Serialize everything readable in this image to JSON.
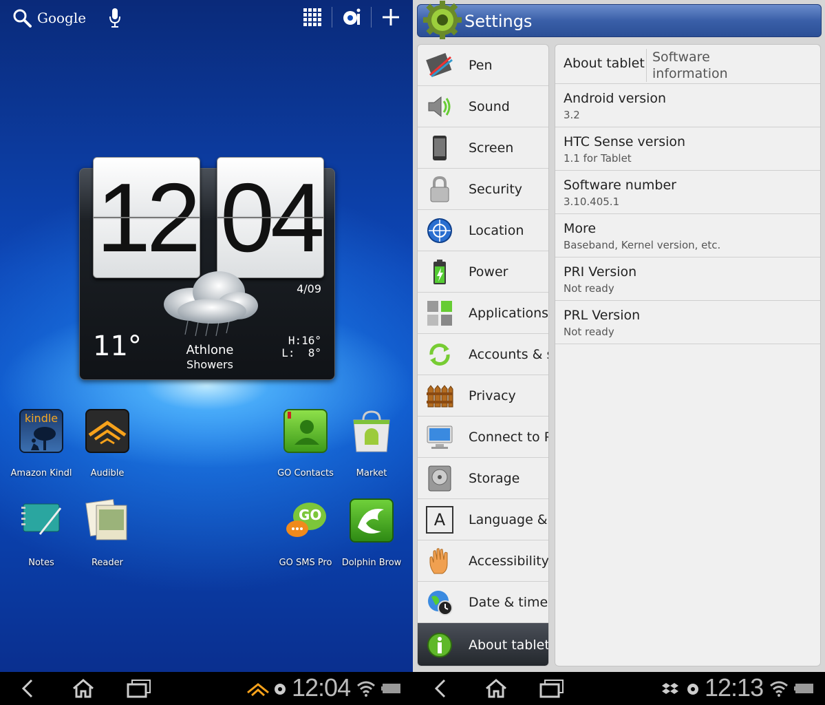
{
  "home": {
    "search_label": "Google",
    "clock": {
      "hour": "12",
      "minute": "04",
      "date": "4/09"
    },
    "weather": {
      "temp": "11°",
      "city": "Athlone",
      "condition": "Showers",
      "high": "H:16°",
      "low": "L:  8°"
    },
    "apps": [
      {
        "name": "Amazon Kindl"
      },
      {
        "name": "Audible"
      },
      {
        "name": "GO Contacts"
      },
      {
        "name": "Market"
      },
      {
        "name": "Notes"
      },
      {
        "name": "Reader"
      },
      {
        "name": "GO SMS Pro"
      },
      {
        "name": "Dolphin Brow"
      }
    ],
    "kindle_label": "kindle",
    "gosms_label": "GO"
  },
  "nav_left": {
    "time": "12:04"
  },
  "nav_right": {
    "time": "12:13"
  },
  "settings": {
    "title": "Settings",
    "categories": [
      {
        "label": "Pen"
      },
      {
        "label": "Sound"
      },
      {
        "label": "Screen"
      },
      {
        "label": "Security"
      },
      {
        "label": "Location"
      },
      {
        "label": "Power"
      },
      {
        "label": "Applications"
      },
      {
        "label": "Accounts & sy"
      },
      {
        "label": "Privacy"
      },
      {
        "label": "Connect to PC"
      },
      {
        "label": "Storage"
      },
      {
        "label": "Language & in"
      },
      {
        "label": "Accessibility"
      },
      {
        "label": "Date & time"
      },
      {
        "label": "About tablet"
      }
    ],
    "header": {
      "about": "About tablet",
      "section_line1": "Software",
      "section_line2": "information"
    },
    "rows": [
      {
        "key": "Android version",
        "value": "3.2"
      },
      {
        "key": "HTC Sense version",
        "value": "1.1 for Tablet"
      },
      {
        "key": "Software number",
        "value": "3.10.405.1"
      },
      {
        "key": "More",
        "value": "Baseband, Kernel version, etc."
      },
      {
        "key": "PRI Version",
        "value": "Not ready"
      },
      {
        "key": "PRL Version",
        "value": "Not ready"
      }
    ],
    "language_icon_letter": "A"
  },
  "colors": {
    "accent": "#2b4f96",
    "home_bg": "#0d47b8",
    "selected": "#23272c"
  }
}
